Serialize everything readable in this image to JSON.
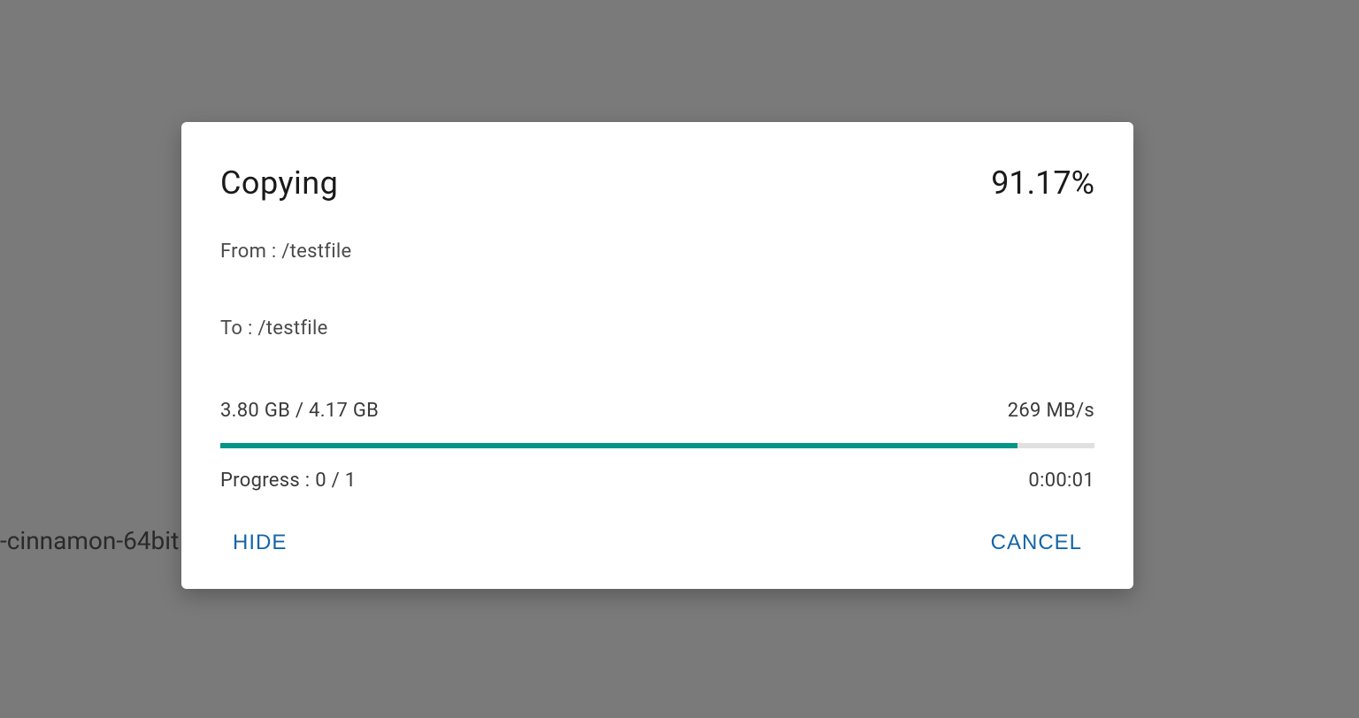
{
  "background": {
    "partial_filename": "-cinnamon-64bit"
  },
  "dialog": {
    "title": "Copying",
    "percent": "91.17%",
    "from_label": "From : /testfile",
    "to_label": "To : /testfile",
    "size_text": "3.80 GB / 4.17 GB",
    "speed": "269 MB/s",
    "progress_fill_width": "91.17%",
    "progress_count": "Progress : 0 / 1",
    "time_remaining": "0:00:01",
    "hide_label": "HIDE",
    "cancel_label": "CANCEL",
    "colors": {
      "accent": "#009688",
      "button_text": "#1565a8"
    }
  }
}
